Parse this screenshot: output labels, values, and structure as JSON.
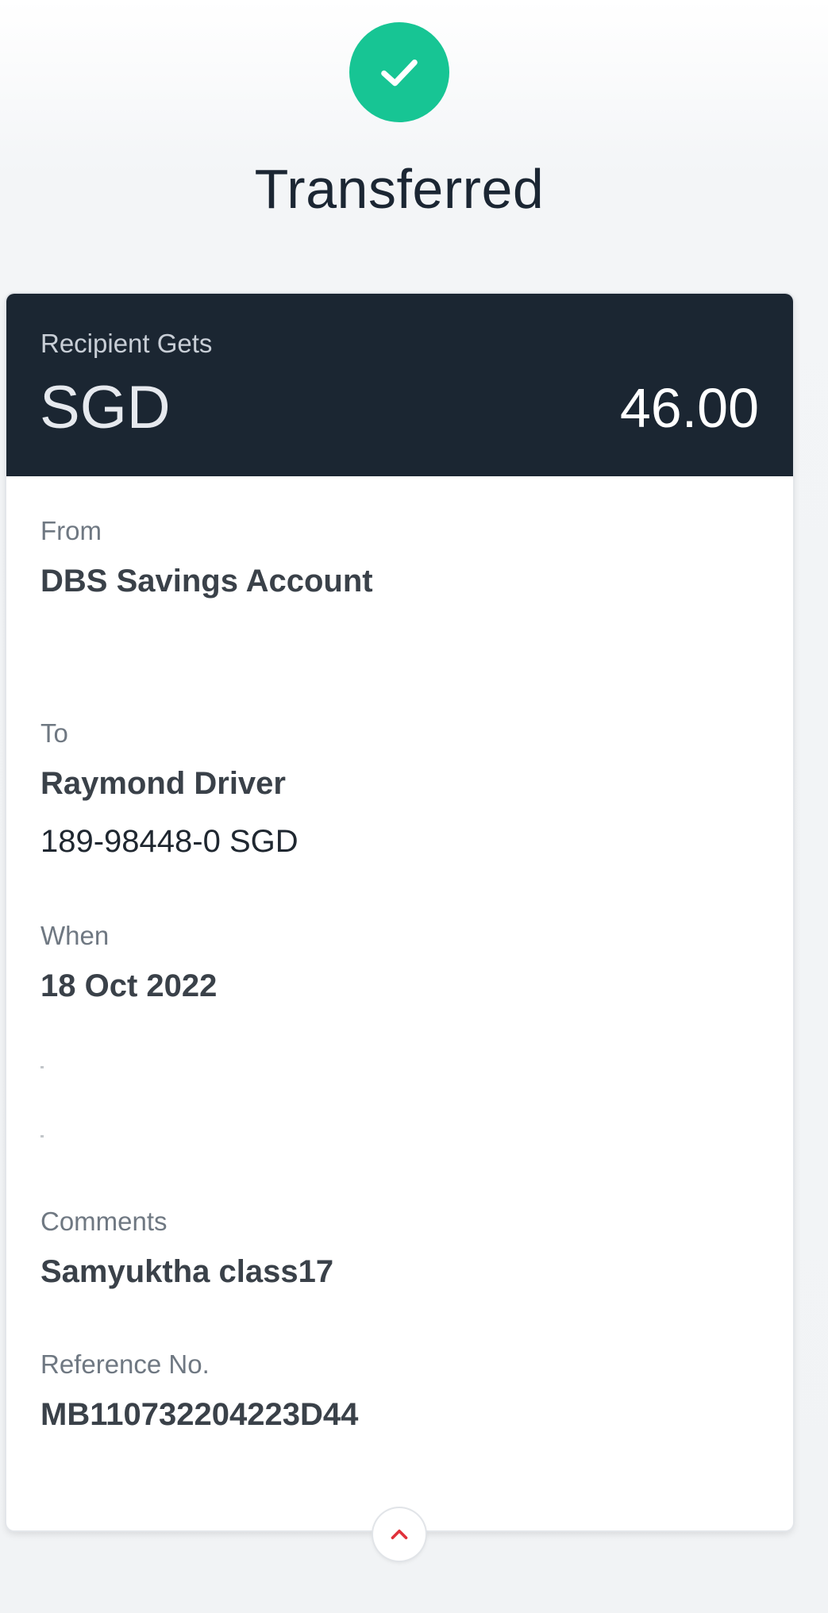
{
  "status": {
    "icon": "check-icon",
    "title": "Transferred",
    "color": "#17c594"
  },
  "amount": {
    "label": "Recipient Gets",
    "currency": "SGD",
    "value": "46.00",
    "background": "#1b2632"
  },
  "from": {
    "label": "From",
    "value": "DBS Savings Account"
  },
  "to": {
    "label": "To",
    "name": "Raymond Driver",
    "account": "189-98448-0  SGD"
  },
  "when": {
    "label": "When",
    "value": "18 Oct 2022"
  },
  "comments": {
    "label": "Comments",
    "value": "Samyuktha class17"
  },
  "reference": {
    "label": "Reference No.",
    "value": "MB110732204223D44"
  },
  "collapse": {
    "icon": "chevron-up-icon",
    "color": "#e0313b"
  }
}
